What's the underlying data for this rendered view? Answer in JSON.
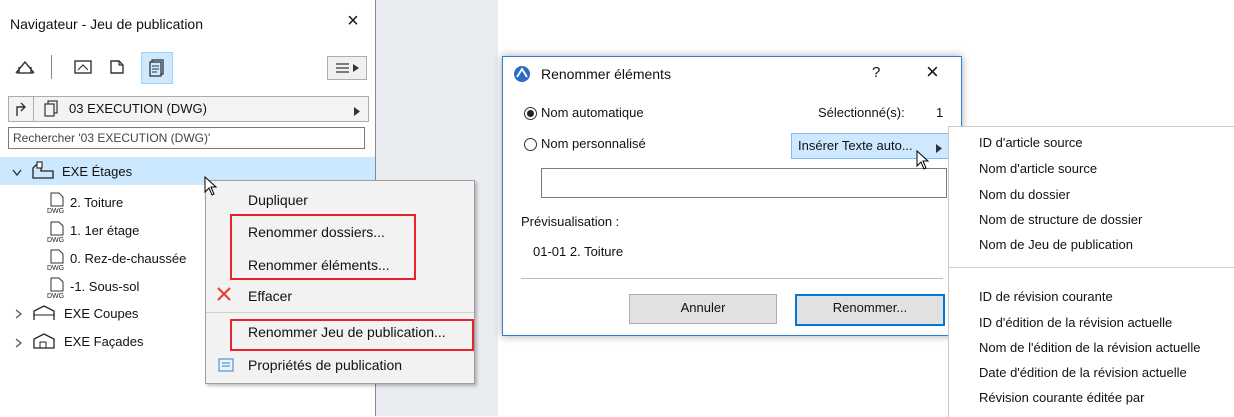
{
  "navigator": {
    "title": "Navigateur - Jeu de publication",
    "publisher_set": "03 EXECUTION (DWG)",
    "search_placeholder": "Rechercher '03 EXECUTION (DWG)'",
    "tree": {
      "folder_selected": "EXE Étages",
      "items": [
        "2. Toiture",
        "1. 1er étage",
        "0. Rez-de-chaussée",
        "-1. Sous-sol"
      ],
      "item_tag": "DWG",
      "folder_coupes": "EXE Coupes",
      "folder_facades": "EXE Façades"
    }
  },
  "context_menu": {
    "items": [
      "Dupliquer",
      "Renommer dossiers...",
      "Renommer éléments...",
      "Effacer",
      "Renommer Jeu de publication...",
      "Propriétés de publication"
    ]
  },
  "dialog": {
    "title": "Renommer éléments",
    "help": "?",
    "close": "×",
    "radio_auto": "Nom automatique",
    "radio_custom": "Nom personnalisé",
    "selected_label": "Sélectionné(s):",
    "selected_count": "1",
    "insert_button": "Insérer Texte auto...",
    "name_field_value": "",
    "preview_label": "Prévisualisation :",
    "preview_value": "01-01 2. Toiture",
    "cancel": "Annuler",
    "rename": "Renommer..."
  },
  "autotext_menu": {
    "group1": [
      "ID d'article source",
      "Nom d'article source",
      "Nom du dossier",
      "Nom de structure de dossier",
      "Nom de Jeu de publication"
    ],
    "group2": [
      "ID de révision courante",
      "ID d'édition de la révision actuelle",
      "Nom de l'édition de la révision actuelle",
      "Date d'édition de la révision actuelle",
      "Révision courante éditée par"
    ]
  },
  "colors": {
    "highlight": "#cce8ff",
    "red_outline": "#e8222a",
    "dialog_accent": "#0078d7"
  }
}
